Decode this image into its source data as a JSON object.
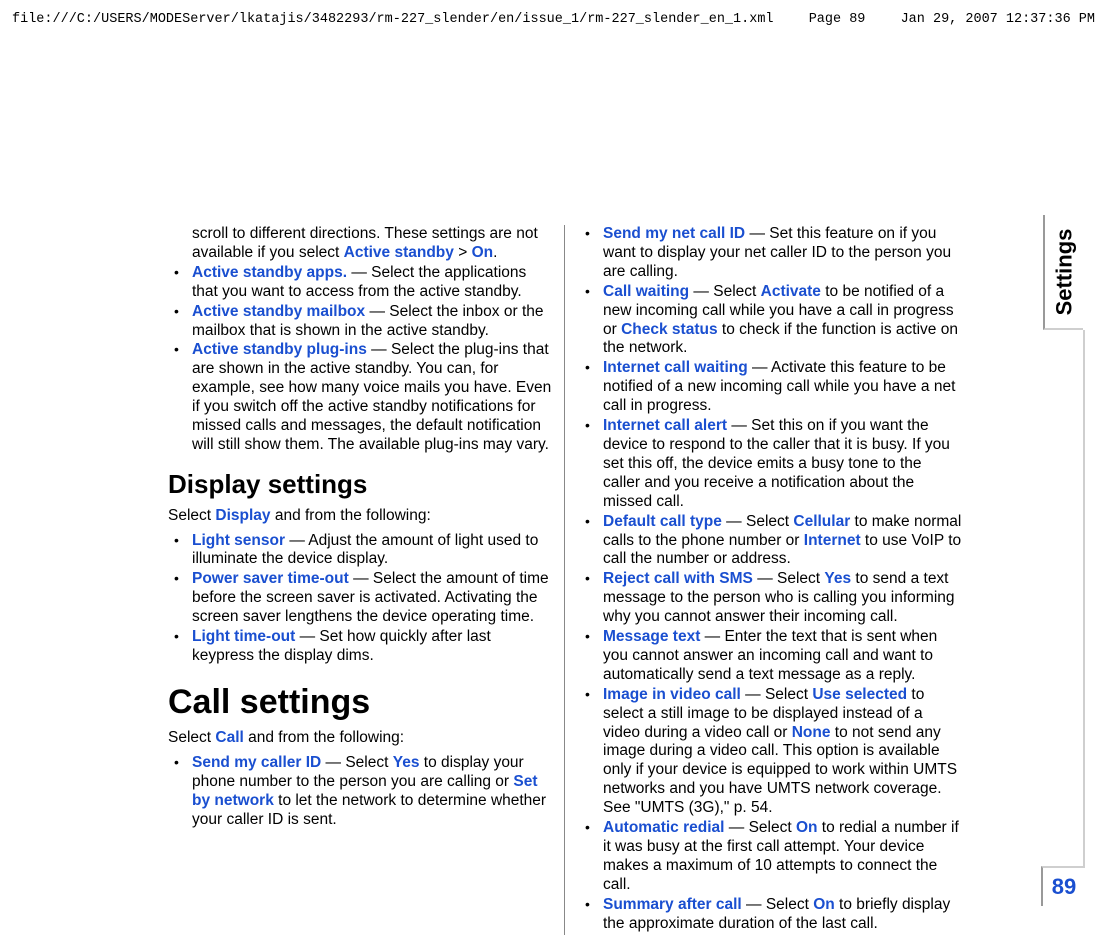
{
  "header": {
    "path": "file:///C:/USERS/MODEServer/lkatajis/3482293/rm-227_slender/en/issue_1/rm-227_slender_en_1.xml",
    "page": "Page 89",
    "datetime": "Jan 29, 2007 12:37:36 PM"
  },
  "side_tab": "Settings",
  "page_number": "89",
  "left": {
    "continuation_1a": "scroll to different directions. These settings are not available if you select ",
    "continuation_1b": "Active standby",
    "continuation_1c": " > ",
    "continuation_1d": "On",
    "continuation_1e": ".",
    "item2_a": "Active standby apps.",
    "item2_b": " — Select the applications that you want to access from the active standby.",
    "item3_a": "Active standby mailbox",
    "item3_b": " — Select the inbox or the mailbox that is shown in the active standby.",
    "item4_a": "Active standby plug-ins",
    "item4_b": " — Select the plug-ins that are shown in the active standby. You can, for example, see how many voice mails you have. Even if you switch off the active standby notifications for missed calls and messages, the default notification will still show them. The available plug-ins may vary.",
    "heading_display": "Display settings",
    "display_intro_a": "Select ",
    "display_intro_b": "Display",
    "display_intro_c": " and from the following:",
    "d1_a": "Light sensor",
    "d1_b": " — Adjust the amount of light used to illuminate the device display.",
    "d2_a": "Power saver time-out",
    "d2_b": " — Select the amount of time before the screen saver is activated. Activating the screen saver lengthens the device operating time.",
    "d3_a": "Light time-out",
    "d3_b": " — Set how quickly after last keypress the display dims.",
    "heading_call": "Call settings",
    "call_intro_a": "Select ",
    "call_intro_b": "Call",
    "call_intro_c": " and from the following:",
    "c1_a": "Send my caller ID",
    "c1_b": " — Select ",
    "c1_c": "Yes",
    "c1_d": " to display your phone number to the person you are calling or ",
    "c1_e": "Set by network",
    "c1_f": " to let the network to determine whether your caller ID is sent."
  },
  "right": {
    "r1_a": "Send my net call ID",
    "r1_b": " — Set this feature on if you want to display your net caller ID to the person you are calling.",
    "r2_a": "Call waiting",
    "r2_b": " — Select ",
    "r2_c": "Activate",
    "r2_d": " to be notified of a new incoming call while you have a call in progress or ",
    "r2_e": "Check status",
    "r2_f": " to check if the function is active on the network.",
    "r3_a": "Internet call waiting",
    "r3_b": " — Activate this feature to be notified of a new incoming call while you have a net call in progress.",
    "r4_a": "Internet call alert",
    "r4_b": " — Set this on if you want the device to respond to the caller that it is busy. If you set this off, the device emits a busy tone to the caller and you receive a notification about the missed call.",
    "r5_a": "Default call type",
    "r5_b": " — Select ",
    "r5_c": "Cellular",
    "r5_d": " to make normal calls to the phone number or ",
    "r5_e": "Internet",
    "r5_f": " to use VoIP to call the number or address.",
    "r6_a": "Reject call with SMS",
    "r6_b": " — Select ",
    "r6_c": "Yes",
    "r6_d": " to send a text message to the person who is calling you informing why you cannot answer their incoming call.",
    "r7_a": "Message text",
    "r7_b": " — Enter the text that is sent when you cannot answer an incoming call and want to automatically send a text message as a reply.",
    "r8_a": "Image in video call",
    "r8_b": " — Select ",
    "r8_c": "Use selected",
    "r8_d": " to select a still image to be displayed instead of a video during a video call or ",
    "r8_e": "None",
    "r8_f": " to not send any image during a video call. This option is available only if your device is equipped to work within UMTS networks and you have UMTS network coverage. See \"UMTS (3G),\" p. 54.",
    "r9_a": "Automatic redial",
    "r9_b": " — Select ",
    "r9_c": "On",
    "r9_d": " to redial a number if it was busy at the first call attempt. Your device makes a maximum of 10 attempts to connect the call.",
    "r10_a": "Summary after call",
    "r10_b": " — Select ",
    "r10_c": "On",
    "r10_d": " to briefly display the approximate duration of the last call."
  }
}
